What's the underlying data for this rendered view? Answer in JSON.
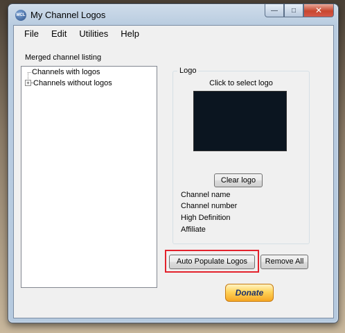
{
  "window": {
    "title": "My Channel Logos",
    "icon_label": "MCL",
    "controls": {
      "minimize": "—",
      "maximize": "□",
      "close": "✕"
    }
  },
  "menu": [
    "File",
    "Edit",
    "Utilities",
    "Help"
  ],
  "listing": {
    "label": "Merged channel listing",
    "nodes": [
      {
        "label": "Channels with logos",
        "expander": ""
      },
      {
        "label": "Channels without logos",
        "expander": "+"
      }
    ]
  },
  "logo_group": {
    "title": "Logo",
    "click_text": "Click to select logo",
    "clear_button": "Clear logo",
    "info": [
      "Channel name",
      "Channel number",
      "High Definition",
      "Affiliate"
    ]
  },
  "buttons": {
    "auto_populate": "Auto Populate Logos",
    "remove_all": "Remove All",
    "donate": "Donate"
  },
  "colors": {
    "highlight": "#e3212b",
    "logo_preview": "#0b1520",
    "donate": "#ffd35a"
  }
}
